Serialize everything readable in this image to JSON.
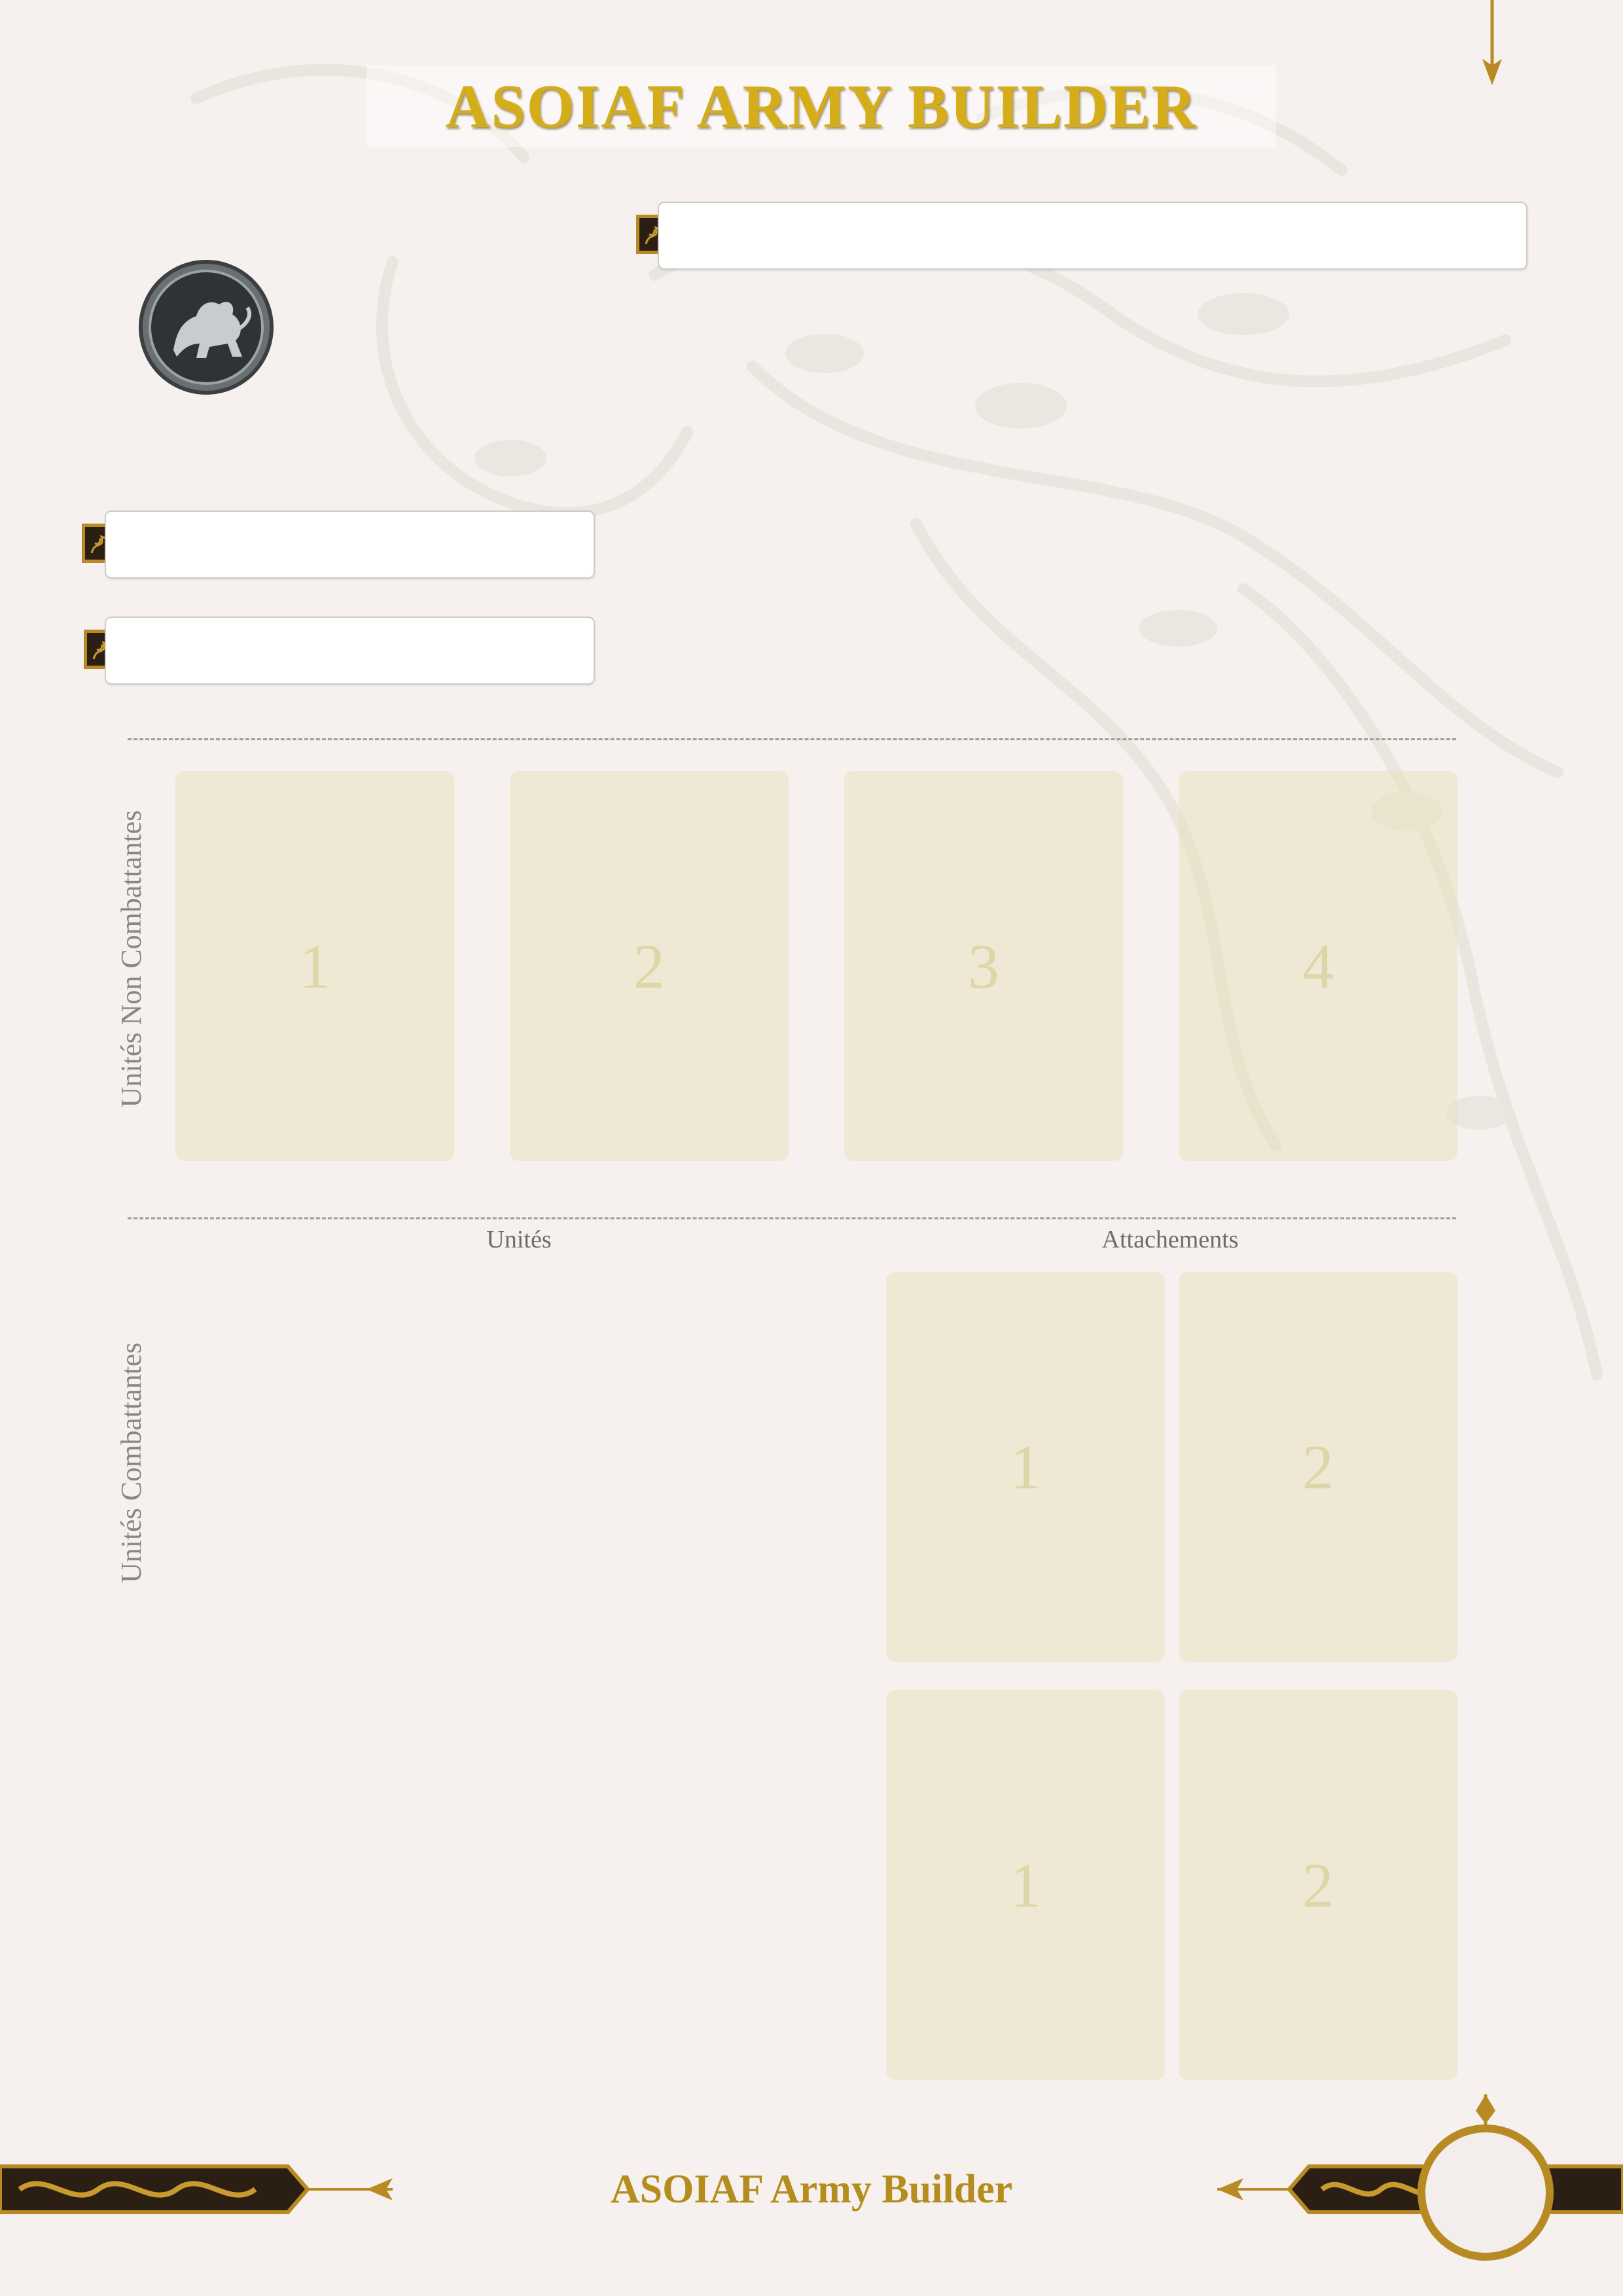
{
  "header": {
    "title": "ASOIAF ARMY BUILDER"
  },
  "fields": {
    "army_name": {
      "value": "",
      "placeholder": ""
    },
    "commander": {
      "value": "",
      "placeholder": ""
    },
    "points": {
      "value": "",
      "placeholder": ""
    }
  },
  "faction": {
    "icon": "lion-emblem-icon"
  },
  "non_combat": {
    "label": "Unités Non Combattantes",
    "slots": [
      "1",
      "2",
      "3",
      "4"
    ]
  },
  "combat": {
    "label": "Unités Combattantes",
    "units_heading": "Unités",
    "attachments_heading": "Attachements",
    "attachment_rows": [
      [
        "1",
        "2"
      ],
      [
        "1",
        "2"
      ]
    ]
  },
  "footer": {
    "text": "ASOIAF Army Builder"
  },
  "colors": {
    "title_gold": "#d4ad18",
    "footer_gold": "#b48d1e",
    "card_fill": "#e9e2c4",
    "page_bg": "#f6f1ee",
    "ornament_dark": "#2b1f14"
  }
}
